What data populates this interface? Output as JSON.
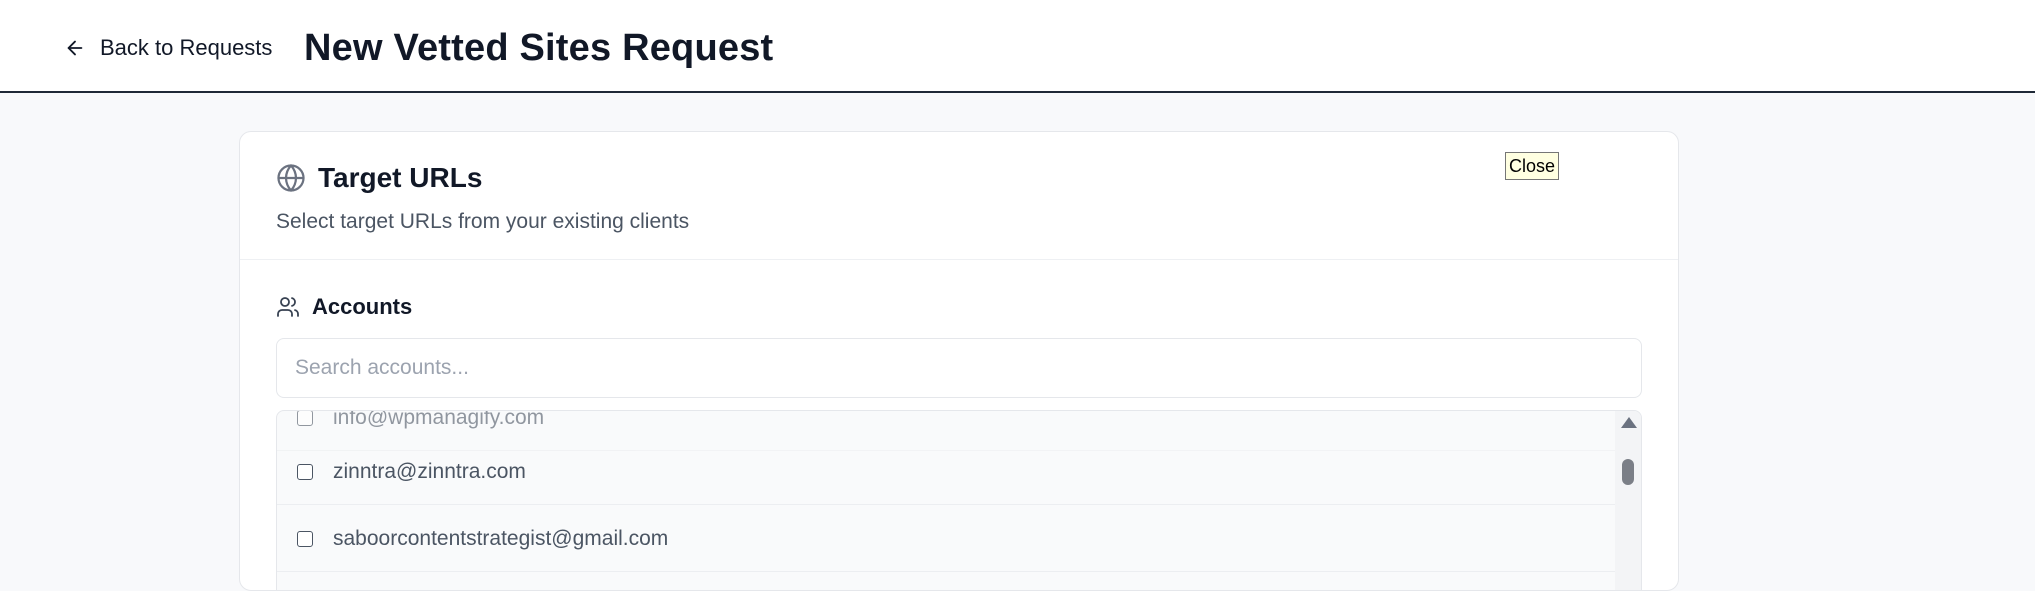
{
  "header": {
    "back_label": "Back to Requests",
    "title": "New Vetted Sites Request"
  },
  "card": {
    "title": "Target URLs",
    "subtitle": "Select target URLs from your existing clients",
    "tooltip": "Close",
    "section_label": "Accounts",
    "search": {
      "placeholder": "Search accounts...",
      "value": ""
    },
    "accounts": [
      {
        "email": "info@wpmanagify.com",
        "checked": false
      },
      {
        "email": "zinntra@zinntra.com",
        "checked": false
      },
      {
        "email": "saboorcontentstrategist@gmail.com",
        "checked": false
      }
    ]
  },
  "icons": {
    "back": "arrow-left-icon",
    "title": "globe-icon",
    "section": "users-icon"
  }
}
